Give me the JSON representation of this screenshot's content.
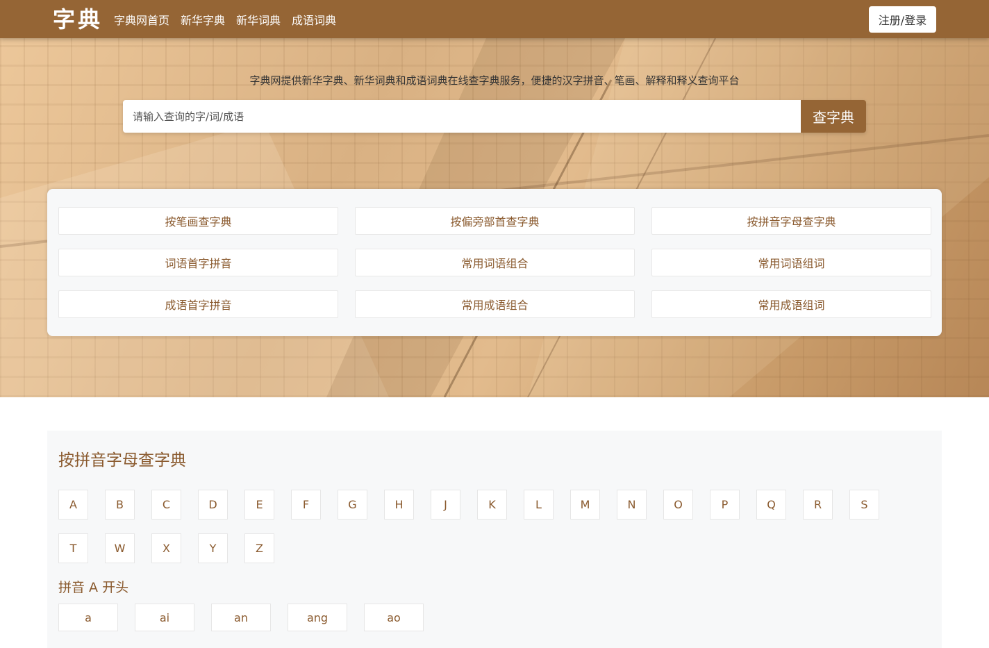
{
  "header": {
    "logo": "字典",
    "nav": [
      "字典网首页",
      "新华字典",
      "新华词典",
      "成语词典"
    ],
    "login_label": "注册/登录"
  },
  "hero": {
    "tagline": "字典网提供新华字典、新华词典和成语词典在线查字典服务，便捷的汉字拼音、笔画、解释和释义查询平台",
    "search": {
      "placeholder": "请输入查询的字/词/成语",
      "button_label": "查字典"
    },
    "quick_links": [
      "按笔画查字典",
      "按偏旁部首查字典",
      "按拼音字母查字典",
      "词语首字拼音",
      "常用词语组合",
      "常用词语组词",
      "成语首字拼音",
      "常用成语组合",
      "常用成语组词"
    ]
  },
  "pinyin": {
    "title": "按拼音字母查字典",
    "letters": [
      "A",
      "B",
      "C",
      "D",
      "E",
      "F",
      "G",
      "H",
      "J",
      "K",
      "L",
      "M",
      "N",
      "O",
      "P",
      "Q",
      "R",
      "S",
      "T",
      "W",
      "X",
      "Y",
      "Z"
    ],
    "subtitle": "拼音 A 开头",
    "syllables": [
      "a",
      "ai",
      "an",
      "ang",
      "ao"
    ]
  },
  "colors": {
    "brand": "#956535",
    "accent_text": "#8a5a2e",
    "panel_bg": "#f7f8f9"
  }
}
